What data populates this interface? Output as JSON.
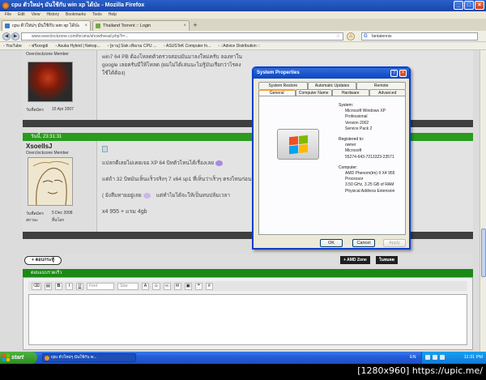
{
  "browser": {
    "title": "cpu ตัวใหม่ๆ มันใช้กับ win xp ได้ป่ะ - Mozilla Firefox",
    "menu": [
      "File",
      "Edit",
      "View",
      "History",
      "Bookmarks",
      "Tools",
      "Help"
    ],
    "tabs": [
      {
        "label": "cpu ตัวใหม่ๆ มันใช้กับ win xp ได้ป่ะ"
      },
      {
        "label": "Thailand Torrent :: Login"
      }
    ],
    "url": "www.overclockzone.com/forums/showthread.php?t=...",
    "search_value": "fantatennis",
    "bookmarks": [
      "YouTube",
      "ฟรีxxxgdi",
      "Asuka Hybrid | Nekop...",
      "[ยาน] Sisk เทียเรม CPU ...",
      "ASUSTeK Computer In...",
      "::Advice Distribution ::"
    ]
  },
  "post1": {
    "text": "win7 64 PB ต้องโหลดตัวตรวจสอบมันมาลงใหม่ครับ ลองหาใน google เลยครับมีให้โหลด (ผมไม่ได้เล่นนะไม่รู้มันเรียกว่าไรคงใช้ได้ต้อง)",
    "joined_label": "วันที่สมัคร",
    "joined": "15 Apr 2007",
    "member_title": "Overclockzone Member"
  },
  "post2": {
    "header": "วันนี้, 23:31:31",
    "username": "XsoelIsJ",
    "member_title": "Overclockzone Member",
    "line1": "แปลกดีเลยไม่เคยเจอ XP 64 บิทตัวไหนได้เรื่องเลย",
    "line2": "แต่ถ้า 32 บิทมันเห็นแร็วจริงๆ 7 x64 sp1 ที่เห็นว่าเร็วๆ ตรงไหนก่อน",
    "line3": "( ยังสีมทายอยู่เลย",
    "line3b": "แต่ทำไมได้จะให้เป็นทบปล้มเวลา",
    "line4": "x4 955 + แรม 4gb",
    "joined_label": "วันที่สมัคร",
    "joined": "5 Dec 2008",
    "status_label": "สถานะ",
    "status": "สิ้นโลก"
  },
  "reply": {
    "button": "+ ตอบกระทู้",
    "btn_amd": "+ AMD Zone",
    "btn_in": "ในหมดด",
    "editor_title": "ตอบแบบรวดเร็ว",
    "toolbar": {
      "font": "Font",
      "size": "Size",
      "bold": "B",
      "italic": "I",
      "underline": "U"
    }
  },
  "dialog": {
    "title": "System Properties",
    "tabs_top": [
      "System Restore",
      "Automatic Updates",
      "Remote"
    ],
    "tabs_bottom": [
      "General",
      "Computer Name",
      "Hardware",
      "Advanced"
    ],
    "system_label": "System:",
    "system_lines": [
      "Microsoft Windows XP",
      "Professional",
      "Version 2002",
      "Service Pack 2"
    ],
    "registered_label": "Registered to:",
    "registered_lines": [
      "owner",
      "Microsoft",
      "55274-643-7213323-23571"
    ],
    "computer_label": "Computer:",
    "computer_lines": [
      "AMD Phenom(tm) II X4 955",
      "Processor",
      "3.50 GHz, 3.25 GB of RAM",
      "Physical Address Extension"
    ],
    "ok": "OK",
    "cancel": "Cancel",
    "apply": "Apply"
  },
  "taskbar": {
    "start": "start",
    "task": "cpu ตัวใหม่ๆ มันใช้กับ w...",
    "lang": "EN",
    "clock": "11:31 PM"
  },
  "watermark": "[1280x960] https://upic.me/"
}
